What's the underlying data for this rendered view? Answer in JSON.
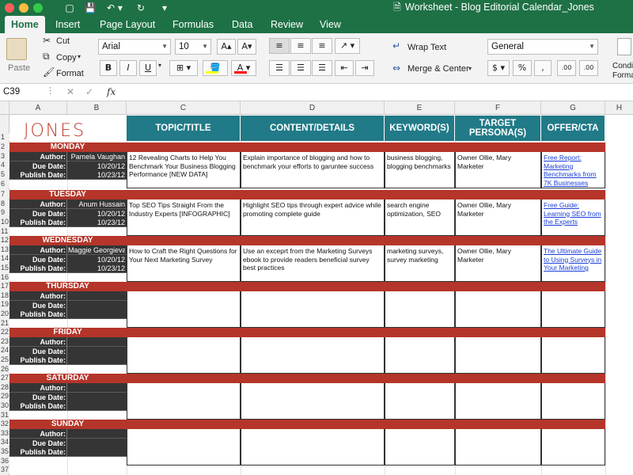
{
  "window": {
    "title": "Worksheet - Blog Editorial Calendar_Jones"
  },
  "tabs": [
    {
      "label": "Home",
      "active": true
    },
    {
      "label": "Insert"
    },
    {
      "label": "Page Layout"
    },
    {
      "label": "Formulas"
    },
    {
      "label": "Data"
    },
    {
      "label": "Review"
    },
    {
      "label": "View"
    }
  ],
  "ribbon": {
    "paste": "Paste",
    "cut": "Cut",
    "copy": "Copy",
    "format": "Format",
    "font_name": "Arial",
    "font_size": "10",
    "wrap_text": "Wrap Text",
    "merge_center": "Merge & Center",
    "number_format": "General",
    "conditional_1": "Condi",
    "conditional_2": "Forma",
    "bold": "B",
    "italic": "I",
    "underline": "U",
    "currency": "$",
    "percent": "%",
    "comma": ",",
    "inc_decimal": ".00",
    "dec_decimal": ".00",
    "font_grow": "A",
    "font_shrink": "A",
    "font_color": "A"
  },
  "formula_bar": {
    "name_box": "C39",
    "fx": "fx"
  },
  "columns": [
    "A",
    "B",
    "C",
    "D",
    "E",
    "F",
    "G",
    "H"
  ],
  "rows": [
    "1",
    "2",
    "3",
    "4",
    "5",
    "6",
    "7",
    "8",
    "9",
    "10",
    "11",
    "12",
    "13",
    "14",
    "15",
    "16",
    "17",
    "18",
    "19",
    "20",
    "21",
    "22",
    "23",
    "24",
    "25",
    "26",
    "27",
    "28",
    "29",
    "30",
    "31",
    "32",
    "33",
    "34",
    "35",
    "36",
    "37"
  ],
  "sheet": {
    "logo": "JONES",
    "headers": [
      "TOPIC/TITLE",
      "CONTENT/DETAILS",
      "KEYWORD(S)",
      "TARGET PERSONA(S)",
      "OFFER/CTA"
    ],
    "labels": {
      "author": "Author:",
      "due": "Due Date:",
      "publish": "Publish Date:"
    },
    "days": [
      {
        "name": "MONDAY",
        "author": "Pamela Vaughan",
        "due": "10/20/12",
        "publish": "10/23/12",
        "topic": "12 Revealing Charts to Help You Benchmark Your Business Blogging Performance [NEW DATA]",
        "content": "Explain importance of blogging and how to benchmark your efforts to garuntee success",
        "keywords": "business blogging, blogging benchmarks",
        "persona": "Owner Ollie, Mary Marketer",
        "offer": "Free Report: Marketing Benchmarks from 7K Businesses"
      },
      {
        "name": "TUESDAY",
        "author": "Anum Hussain",
        "due": "10/20/12",
        "publish": "10/23/12",
        "topic": "Top SEO Tips Straight From the Industry Experts [INFOGRAPHIC]",
        "content": "Highlight SEO tips through expert advice while promoting complete guide",
        "keywords": "search engine optimization, SEO",
        "persona": "Owner Ollie, Mary Marketer",
        "offer": "Free Guide: Learning SEO from the Experts"
      },
      {
        "name": "WEDNESDAY",
        "author": "Maggie Georgieva",
        "due": "10/20/12",
        "publish": "10/23/12",
        "topic": "How to Craft the Right Questions for Your Next Marketing Survey",
        "content": "Use an exceprt from the Marketing Surveys ebook to provide readers beneficial survey best practices",
        "keywords": "marketing surveys, survey marketing",
        "persona": "Owner Ollie, Mary Marketer",
        "offer": "The Ultimate Guide to Using Surveys in Your Marketing"
      },
      {
        "name": "THURSDAY",
        "author": "",
        "due": "",
        "publish": "",
        "topic": "",
        "content": "",
        "keywords": "",
        "persona": "",
        "offer": ""
      },
      {
        "name": "FRIDAY",
        "author": "",
        "due": "",
        "publish": "",
        "topic": "",
        "content": "",
        "keywords": "",
        "persona": "",
        "offer": ""
      },
      {
        "name": "SATURDAY",
        "author": "",
        "due": "",
        "publish": "",
        "topic": "",
        "content": "",
        "keywords": "",
        "persona": "",
        "offer": ""
      },
      {
        "name": "SUNDAY",
        "author": "",
        "due": "",
        "publish": "",
        "topic": "",
        "content": "",
        "keywords": "",
        "persona": "",
        "offer": ""
      }
    ]
  }
}
